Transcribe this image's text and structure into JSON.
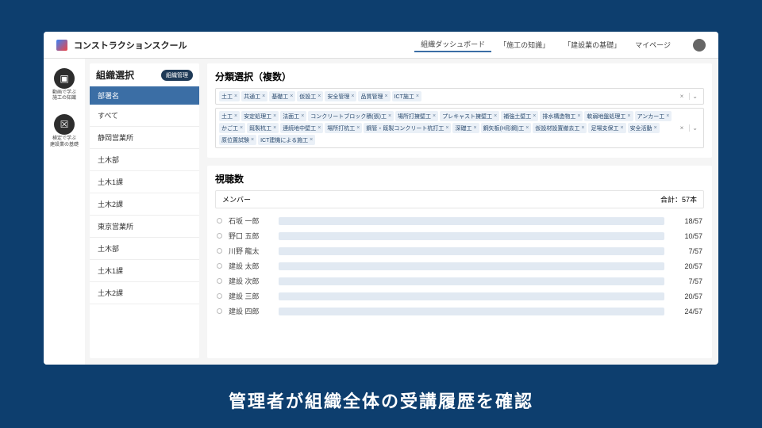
{
  "header": {
    "brand": "コンストラクションスクール",
    "nav": [
      "組織ダッシュボード",
      "施工の知識",
      "建設業の基礎",
      "マイページ"
    ]
  },
  "rail": [
    {
      "label": "動画で学ぶ\n施工の知識",
      "glyph": "▣"
    },
    {
      "label": "検定で学ぶ\n建設業の基礎",
      "glyph": "☒"
    }
  ],
  "org": {
    "title": "組織選択",
    "badge": "組織管理",
    "dept_header": "部署名",
    "items": [
      "すべて",
      "静岡営業所",
      "土木部",
      "土木1課",
      "土木2課",
      "東京営業所",
      "土木部",
      "土木1課",
      "土木2課"
    ]
  },
  "categories": {
    "title": "分類選択（複数）",
    "rows": [
      [
        "土工",
        "共通工",
        "基礎工",
        "仮設工",
        "安全管理",
        "品質管理",
        "ICT施工"
      ],
      [
        "土工",
        "安定処理工",
        "法面工",
        "コンクリートブロック積(張)工",
        "場所打擁壁工",
        "プレキャスト擁壁工",
        "補強土壁工",
        "排水構造物工",
        "軟弱地盤処理工",
        "アンカー工",
        "かご工",
        "既製杭工",
        "連続地中壁工",
        "場所打杭工",
        "鋼管・既製コンクリート杭打工",
        "深礎工",
        "鋼矢板(H形鋼)工",
        "仮設材設置撤去工",
        "足場支保工",
        "安全活動",
        "原位置試験",
        "ICT建機による施工"
      ]
    ]
  },
  "views": {
    "title": "視聴数",
    "members_label": "メンバー",
    "total_label": "合計：57本",
    "total": 57,
    "members": [
      {
        "name": "石坂 一郎",
        "value": 18
      },
      {
        "name": "野口 五郎",
        "value": 10
      },
      {
        "name": "川野 龍太",
        "value": 7
      },
      {
        "name": "建設 太郎",
        "value": 20
      },
      {
        "name": "建設 次郎",
        "value": 7
      },
      {
        "name": "建設 三郎",
        "value": 20
      },
      {
        "name": "建設 四郎",
        "value": 24
      }
    ]
  },
  "caption": "管理者が組織全体の受講履歴を確認"
}
